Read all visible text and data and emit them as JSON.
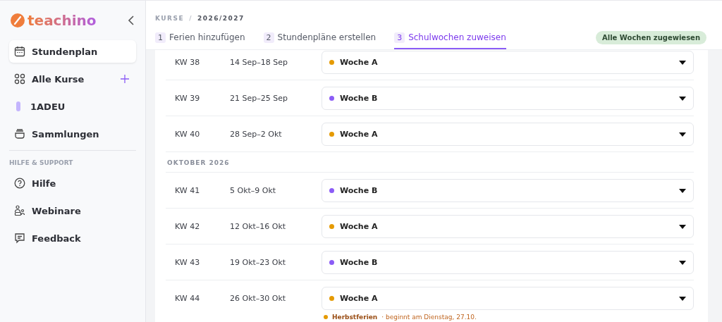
{
  "sidebar": {
    "logo": "teachino",
    "items": [
      {
        "label": "Stundenplan",
        "selected": true
      },
      {
        "label": "Alle Kurse",
        "selected": false,
        "add": true
      },
      {
        "label": "1ADEU",
        "selected": false,
        "color": "#c4b5fd"
      },
      {
        "label": "Sammlungen",
        "selected": false
      }
    ],
    "section_title": "HILFE & SUPPORT",
    "support_items": [
      {
        "label": "Hilfe"
      },
      {
        "label": "Webinare"
      },
      {
        "label": "Feedback"
      }
    ]
  },
  "breadcrumb": {
    "parent": "KURSE",
    "separator": "/",
    "current": "2026/2027"
  },
  "tabs": [
    {
      "number": "1",
      "label": "Ferien hinzufügen",
      "selected": false
    },
    {
      "number": "2",
      "label": "Stundenpläne erstellen",
      "selected": false
    },
    {
      "number": "3",
      "label": "Schulwochen zuweisen",
      "selected": true
    }
  ],
  "status_badge": "Alle Wochen zugewiesen",
  "groups": [
    {
      "weeks": [
        {
          "kw": "KW 38",
          "dates": "14 Sep–18 Sep",
          "week": "Woche A",
          "color": "#e59a00"
        },
        {
          "kw": "KW 39",
          "dates": "21 Sep–25 Sep",
          "week": "Woche B",
          "color": "#8b5cf6"
        },
        {
          "kw": "KW 40",
          "dates": "28 Sep–2 Okt",
          "week": "Woche A",
          "color": "#e59a00"
        }
      ]
    },
    {
      "heading": "OKTOBER 2026",
      "weeks": [
        {
          "kw": "KW 41",
          "dates": "5 Okt–9 Okt",
          "week": "Woche B",
          "color": "#8b5cf6"
        },
        {
          "kw": "KW 42",
          "dates": "12 Okt–16 Okt",
          "week": "Woche A",
          "color": "#e59a00"
        },
        {
          "kw": "KW 43",
          "dates": "19 Okt–23 Okt",
          "week": "Woche B",
          "color": "#8b5cf6"
        },
        {
          "kw": "KW 44",
          "dates": "26 Okt–30 Okt",
          "week": "Woche A",
          "color": "#e59a00",
          "note": {
            "name": "Herbstferien",
            "text": "· beginnt am Dienstag, 27.10.",
            "color": "#e59a00"
          }
        }
      ]
    }
  ]
}
